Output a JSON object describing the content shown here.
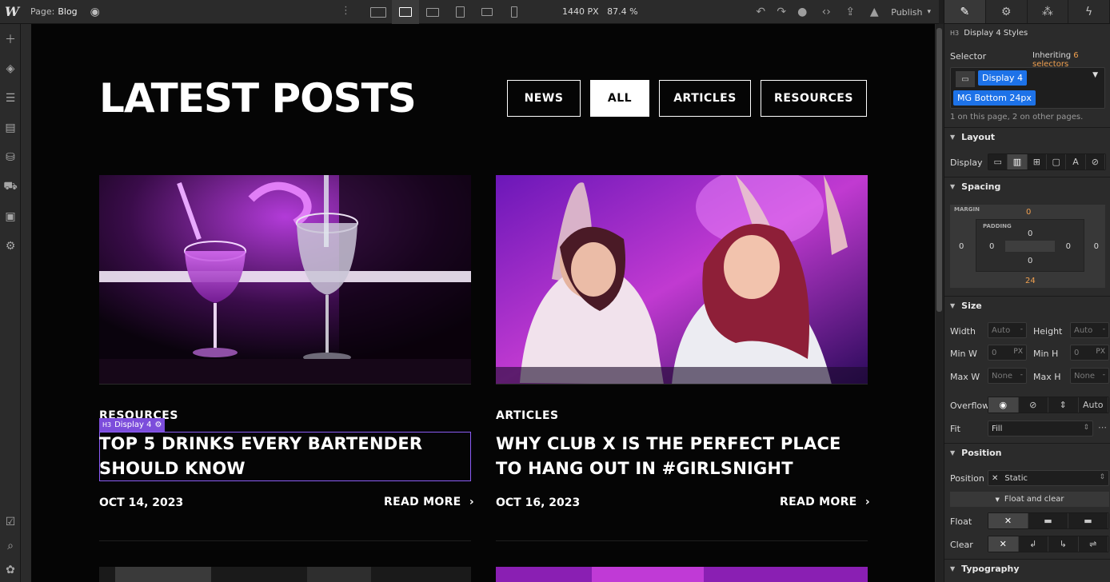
{
  "topbar": {
    "logo": "W",
    "page_label": "Page:",
    "page_name": "Blog",
    "viewport_width": "1440 PX",
    "zoom": "87.4 %",
    "publish_label": "Publish"
  },
  "site": {
    "title": "LATEST POSTS",
    "filters": [
      "NEWS",
      "ALL",
      "ARTICLES",
      "RESOURCES"
    ],
    "active_filter": "ALL",
    "posts": [
      {
        "category": "RESOURCES",
        "title": "TOP 5 DRINKS EVERY BARTENDER SHOULD KNOW",
        "date": "OCT 14, 2023",
        "cta": "READ MORE"
      },
      {
        "category": "ARTICLES",
        "title": "WHY CLUB X IS THE PERFECT PLACE TO HANG OUT IN #GIRLSNIGHT",
        "date": "OCT 16, 2023",
        "cta": "READ MORE"
      }
    ],
    "selection_tag": "Display 4",
    "selection_tag_prefix": "H3"
  },
  "panel": {
    "header_prefix": "H3",
    "header": "Display 4 Styles",
    "selector_label": "Selector",
    "inheriting_label": "Inheriting",
    "inheriting_count": "6 selectors",
    "chips": [
      "Display 4",
      "MG Bottom 24px"
    ],
    "selector_note": "1 on this page, 2 on other pages.",
    "sections": {
      "layout": "Layout",
      "spacing": "Spacing",
      "size": "Size",
      "position": "Position",
      "typography": "Typography"
    },
    "display_label": "Display",
    "spacing": {
      "margin_label": "MARGIN",
      "padding_label": "PADDING",
      "margin_top": "0",
      "margin_right": "0",
      "margin_bottom": "24",
      "margin_left": "0",
      "padding_top": "0",
      "padding_right": "0",
      "padding_bottom": "0",
      "padding_left": "0"
    },
    "size": {
      "width_label": "Width",
      "width_val": "Auto",
      "height_label": "Height",
      "height_val": "Auto",
      "minw_label": "Min W",
      "minw_val": "0",
      "minw_unit": "PX",
      "minh_label": "Min H",
      "minh_val": "0",
      "minh_unit": "PX",
      "maxw_label": "Max W",
      "maxw_val": "None",
      "maxh_label": "Max H",
      "maxh_val": "None",
      "dash": "-",
      "overflow_label": "Overflow",
      "overflow_auto": "Auto",
      "fit_label": "Fit",
      "fit_val": "Fill"
    },
    "position": {
      "position_label": "Position",
      "position_val": "Static",
      "float_clear_label": "Float and clear",
      "float_label": "Float",
      "clear_label": "Clear"
    },
    "colors": {
      "accent": "#1d72e8",
      "orange": "#f0a050",
      "selection": "#8b5cf6"
    }
  }
}
